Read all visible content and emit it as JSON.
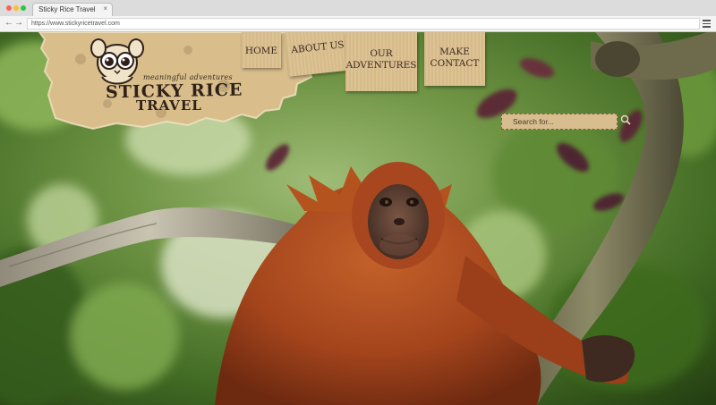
{
  "browser": {
    "tab_title": "Sticky Rice Travel",
    "tab_close": "×",
    "url": "https://www.stickyricetravel.com",
    "back_glyph": "←",
    "forward_glyph": "→"
  },
  "site": {
    "tagline": "meaningful adventures",
    "logo_line1": "STICKY RICE",
    "logo_line2": "TRAVEL"
  },
  "nav": {
    "home": "HOME",
    "about": "ABOUT US",
    "adventures_1": "OUR",
    "adventures_2": "ADVENTURES",
    "contact_1": "MAKE",
    "contact_2": "CONTACT"
  },
  "search": {
    "placeholder": "Search for..."
  },
  "colors": {
    "paper": "#dcc08f",
    "ink": "#2f211a",
    "fur": "#a8471f"
  },
  "icons": [
    "tarsier-logo-icon",
    "search-icon",
    "menu-icon",
    "back-arrow-icon",
    "forward-arrow-icon",
    "close-icon"
  ]
}
